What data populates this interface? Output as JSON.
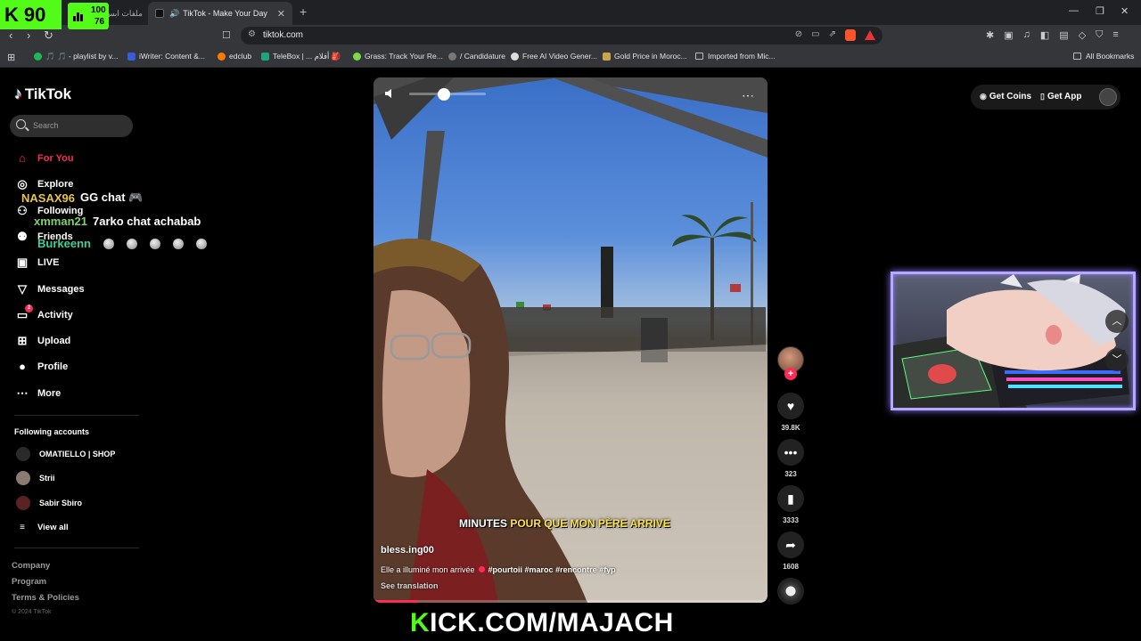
{
  "browser": {
    "tabs": [
      {
        "label": "ملفات ابس",
        "active": false
      },
      {
        "label": "TikTok - Make Your Day",
        "active": true
      }
    ],
    "url": "tiktok.com",
    "bookmarks": [
      {
        "label": "🎵 🎵 - playlist by v...",
        "color": "#1db954"
      },
      {
        "label": "iWriter: Content &...",
        "color": "#3b5bdb"
      },
      {
        "label": "edclub",
        "color": "#ff7a00"
      },
      {
        "label": "TeleBox | ... أفلام 🎒",
        "color": "#1fa37a"
      },
      {
        "label": "Grass: Track Your Re...",
        "color": "#7bd84b"
      },
      {
        "label": "/ Candidature",
        "color": "#777777"
      },
      {
        "label": "Free AI Video Gener...",
        "color": "#dddddd"
      },
      {
        "label": "Gold Price in Moroc...",
        "color": "#caa64a"
      },
      {
        "label": "Imported from Mic...",
        "color": "#bbbbbb"
      }
    ],
    "all_bookmarks": "All Bookmarks"
  },
  "tiktok": {
    "logo": "TikTok",
    "search_placeholder": "Search",
    "nav": [
      {
        "label": "For You",
        "icon": "home-icon",
        "active": true
      },
      {
        "label": "Explore",
        "icon": "compass-icon"
      },
      {
        "label": "Following",
        "icon": "following-icon"
      },
      {
        "label": "Friends",
        "icon": "friends-icon"
      },
      {
        "label": "LIVE",
        "icon": "live-icon"
      },
      {
        "label": "Messages",
        "icon": "messages-icon"
      },
      {
        "label": "Activity",
        "icon": "activity-icon",
        "badge": "2"
      },
      {
        "label": "Upload",
        "icon": "upload-icon"
      },
      {
        "label": "Profile",
        "icon": "profile-icon"
      },
      {
        "label": "More",
        "icon": "more-icon"
      }
    ],
    "following_title": "Following accounts",
    "following_accounts": [
      {
        "name": "OMATIELLO | SHOP"
      },
      {
        "name": "Strii"
      },
      {
        "name": "Sabir Sbiro"
      }
    ],
    "view_all": "View all",
    "footer": [
      "Company",
      "Program",
      "Terms & Policies"
    ],
    "copyright": "© 2024 TikTok",
    "get_coins": "Get Coins",
    "get_app": "Get App"
  },
  "video": {
    "caption_pre": "MINUTES",
    "caption_hl": "POUR QUE MON PÈRE ARRIVE",
    "username": "bless.ing00",
    "description": "Elle a illuminé mon arrivée",
    "hashtags": "#pourtoii #maroc #rencontre #fyp",
    "see_translation": "See translation",
    "likes": "39.8K",
    "comments": "323",
    "saves": "3333",
    "shares": "1608",
    "progress": 0.11
  },
  "stream": {
    "follower_count": "90",
    "viewers_top": "100",
    "viewers_bottom": "76",
    "chat": [
      {
        "user": "NASAX96",
        "msg": "GG chat 🎮"
      },
      {
        "user": "xmman21",
        "msg": "7arko chat achabab"
      },
      {
        "user": "Burkeenn",
        "msg": ""
      }
    ],
    "kick_url_k": "K",
    "kick_url_rest": "ICK.COM/MAJACH"
  }
}
